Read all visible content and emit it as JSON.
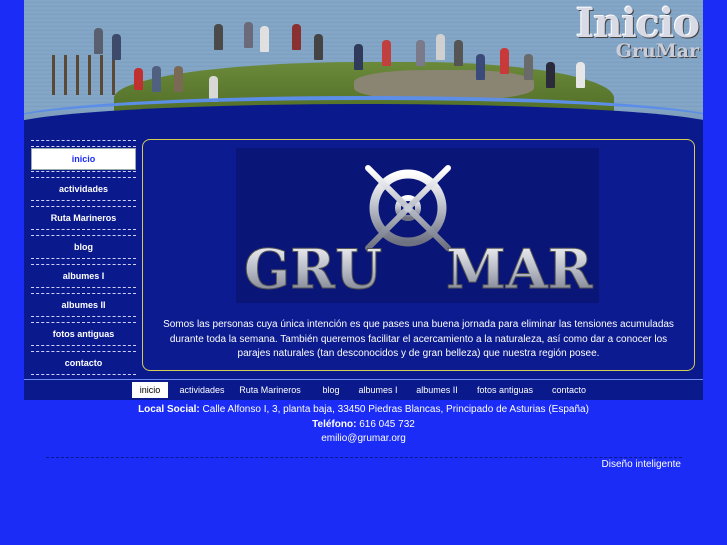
{
  "banner": {
    "title": "Inicio",
    "subtitle": "GruMar"
  },
  "sidenav": {
    "items": [
      {
        "label": "inicio",
        "active": true
      },
      {
        "label": "actividades"
      },
      {
        "label": "Ruta Marineros"
      },
      {
        "label": "blog"
      },
      {
        "label": "albumes I"
      },
      {
        "label": "albumes II"
      },
      {
        "label": "fotos antiguas"
      },
      {
        "label": "contacto"
      }
    ]
  },
  "logo": {
    "text_left": "GRU",
    "text_right": "MAR"
  },
  "main": {
    "intro": "Somos las personas cuya única intención es que pases una buena jornada para eliminar las tensiones acumuladas durante toda la semana. También queremos facilitar el acercamiento a la naturaleza, así como dar a conocer los parajes naturales (tan desconocidos y de gran belleza) que nuestra región posee."
  },
  "topnav": {
    "items": [
      {
        "label": "inicio",
        "active": true
      },
      {
        "label": "actividades"
      },
      {
        "label": "Ruta Marineros"
      },
      {
        "label": "blog"
      },
      {
        "label": "albumes I"
      },
      {
        "label": "albumes II"
      },
      {
        "label": "fotos antiguas"
      },
      {
        "label": "contacto"
      }
    ]
  },
  "footer": {
    "local_label": "Local Social:",
    "local_value": "Calle Alfonso I, 3, planta baja, 33450 Piedras Blancas, Principado de Asturias (España)",
    "phone_label": "Teléfono:",
    "phone_value": "616 045 732",
    "email": "emilio@grumar.org",
    "credit": "Diseño inteligente"
  },
  "colors": {
    "page_bg": "#1a2cf5",
    "panel_bg": "#0a1a8c",
    "content_border": "#d5cc55"
  }
}
